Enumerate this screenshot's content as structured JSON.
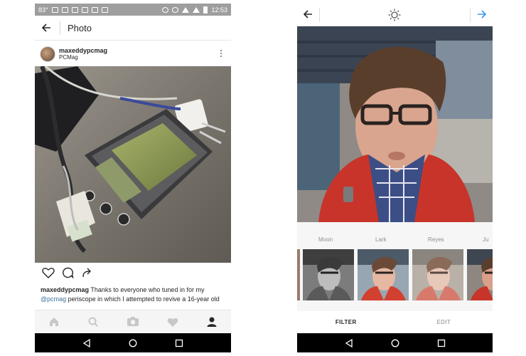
{
  "left_phone": {
    "status_bar": {
      "temperature": "83°",
      "time": "12:53"
    },
    "app_bar": {
      "title": "Photo"
    },
    "post": {
      "username": "maxeddypcmag",
      "location": "PCMag",
      "caption_username": "maxeddypcmag",
      "caption_text_1": " Thanks to everyone who tuned in for my ",
      "caption_mention": "@pcmag",
      "caption_text_2": " periscope in which I attempted to revive a 16-year old"
    },
    "icons": {
      "like": "heart-icon",
      "comment": "comment-icon",
      "share": "share-icon",
      "more": "more-vert-icon"
    },
    "bottom_tabs": [
      "home-icon",
      "search-icon",
      "camera-icon",
      "activity-heart-icon",
      "profile-icon"
    ]
  },
  "right_phone": {
    "filters": {
      "names": [
        "Moon",
        "Lark",
        "Reyes",
        "Ju"
      ]
    },
    "modes": {
      "filter_label": "FILTER",
      "edit_label": "EDIT"
    },
    "colors": {
      "accent_blue": "#3897f0",
      "jacket_red": "#c8342a"
    }
  }
}
